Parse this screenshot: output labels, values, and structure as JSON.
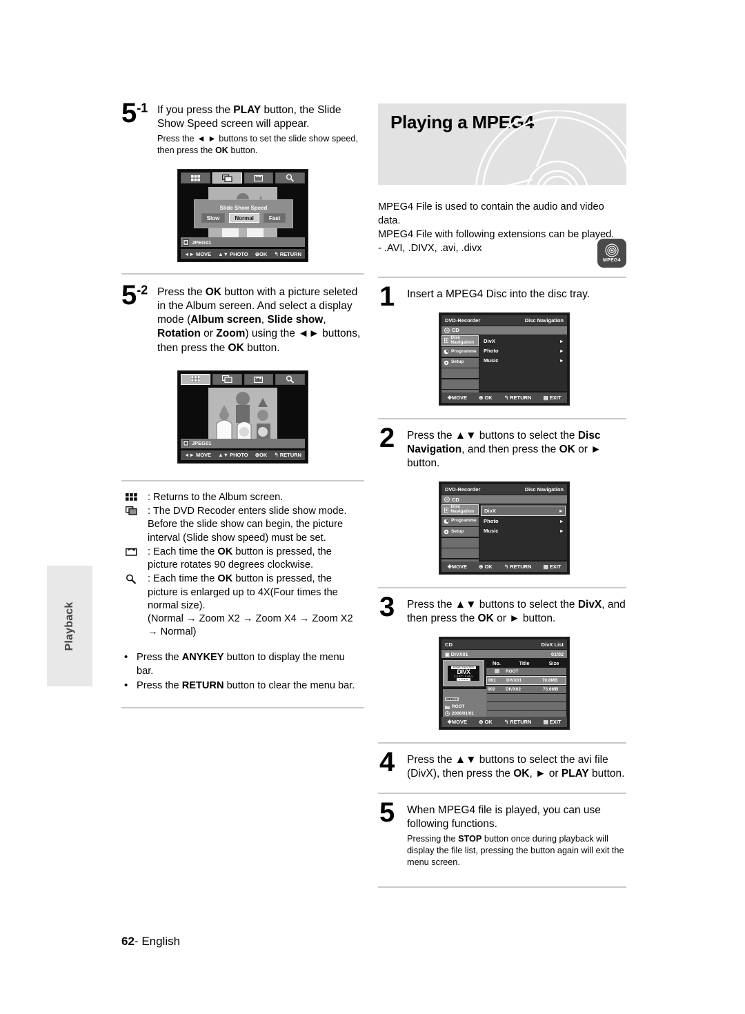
{
  "page": {
    "number": "62",
    "language": "English",
    "side_tab": "Playback"
  },
  "left_column": {
    "step_5_1": {
      "num": "5",
      "sup": "-1",
      "line1_a": "If you press the ",
      "line1_b": "PLAY",
      "line1_c": " button, the Slide Show Speed screen will appear.",
      "sub_a": "Press the ",
      "sub_arrows": "◄ ►",
      "sub_b": " buttons to set the slide show speed, then press the ",
      "sub_c": "OK",
      "sub_d": " button."
    },
    "osd_slideshow": {
      "toolbar_icons": [
        "album-icon",
        "slideshow-icon",
        "rotate-icon",
        "zoom-icon"
      ],
      "selected_tool": "slideshow-icon",
      "dialog_title": "Slide Show Speed",
      "options": [
        "Slow",
        "Normal",
        "Fast"
      ],
      "selected_option": "Normal",
      "file_label": "JPEG01",
      "keys": [
        "MOVE",
        "PHOTO",
        "OK",
        "RETURN"
      ]
    },
    "step_5_2": {
      "num": "5",
      "sup": "-2",
      "t1": "Press the ",
      "t2": "OK",
      "t3": " button with a picture seleted in the Album sereen. And select a display mode (",
      "t4": "Album screen",
      "t5": ", ",
      "t6": "Slide show",
      "t7": ", ",
      "t8": "Rotation",
      "t9": " or ",
      "t10": "Zoom",
      "t11": ") using the ",
      "t12": "◄►",
      "t13": " buttons, then press the ",
      "t14": "OK",
      "t15": " button."
    },
    "osd_album": {
      "toolbar_icons": [
        "album-icon",
        "slideshow-icon",
        "rotate-icon",
        "zoom-icon"
      ],
      "selected_tool": "album-icon",
      "file_label": "JPEG01",
      "keys": [
        "MOVE",
        "PHOTO",
        "OK",
        "RETURN"
      ]
    },
    "icon_list": [
      {
        "icon": "album-grid-icon",
        "text": ": Returns to the Album screen."
      },
      {
        "icon": "slideshow-icon",
        "text": ": The DVD Recoder enters slide show mode. Before the slide show can begin, the picture interval (Slide show speed) must be set."
      },
      {
        "icon": "rotate-icon",
        "text_a": ": Each time the ",
        "text_b": "OK",
        "text_c": " button is pressed, the picture rotates 90 degrees clockwise."
      },
      {
        "icon": "zoom-magnifier-icon",
        "text_a": ": Each time the ",
        "text_b": "OK",
        "text_c": " button is pressed, the picture is enlarged up to 4X(Four times the normal size).",
        "text_d": "(Normal → Zoom X2 → Zoom X4 → Zoom X2 → Normal)"
      }
    ],
    "bullets": [
      {
        "a": "Press the ",
        "b": "ANYKEY",
        "c": " button to display the menu bar."
      },
      {
        "a": "Press the ",
        "b": "RETURN",
        "c": " button to clear the menu bar."
      }
    ]
  },
  "right_column": {
    "title": "Playing a MPEG4",
    "intro_lines": [
      "MPEG4 File is used to contain the audio and video data.",
      "MPEG4 File with following extensions can be played.",
      "- .AVI, .DIVX, .avi, .divx"
    ],
    "badge": {
      "icon": "mpeg4-disc-icon",
      "label": "MPEG4"
    },
    "step1": {
      "num": "1",
      "text": "Insert a MPEG4 Disc into the disc tray."
    },
    "step2": {
      "num": "2",
      "a": "Press the ",
      "arrows": "▲▼",
      "b": " buttons to select the ",
      "c": "Disc Navigation",
      "d": ", and then press the ",
      "e": "OK",
      "f": " or ",
      "g": "►",
      "h": " button."
    },
    "step3": {
      "num": "3",
      "a": "Press the ",
      "arrows": "▲▼",
      "b": " buttons to select the ",
      "c": "DivX",
      "d": ", and then press the ",
      "e": "OK",
      "f": " or ",
      "g": "►",
      "h": " button."
    },
    "step4": {
      "num": "4",
      "a": "Press the ",
      "arrows": "▲▼",
      "b": " buttons to select the avi file (DivX), then press the ",
      "c": "OK",
      "d": ", ",
      "e": "►",
      "f": " or ",
      "g": "PLAY",
      "h": " button."
    },
    "step5": {
      "num": "5",
      "text": "When MPEG4 file is played, you can use following functions.",
      "sub_a": "Pressing the ",
      "sub_b": "STOP",
      "sub_c": " button once during playback will display the file list, pressing the button again will exit the menu screen."
    },
    "osd_nav_1": {
      "device": "DVD-Recorder",
      "header_right": "Disc Navigation",
      "disc": "CD",
      "sidebar": [
        "Disc Navigation",
        "Programme",
        "Setup"
      ],
      "sidebar_selected": "Disc Navigation",
      "items": [
        "DivX",
        "Photo",
        "Music"
      ],
      "item_selected": "",
      "keys": [
        "MOVE",
        "OK",
        "RETURN",
        "EXIT"
      ]
    },
    "osd_nav_2": {
      "device": "DVD-Recorder",
      "header_right": "Disc Navigation",
      "disc": "CD",
      "sidebar": [
        "Disc Navigation",
        "Programme",
        "Setup"
      ],
      "sidebar_selected": "Disc Navigation",
      "items": [
        "DivX",
        "Photo",
        "Music"
      ],
      "item_selected": "DivX",
      "keys": [
        "MOVE",
        "OK",
        "RETURN",
        "EXIT"
      ]
    },
    "osd_divx_list": {
      "header_left": "CD",
      "header_right": "DivX List",
      "sub_left": "DIVX01",
      "sub_right": "01/02",
      "logo": {
        "top": "HOME THEATER",
        "main": "DIVX",
        "certified": "CERTIFIED",
        "bottom": "VIDEO"
      },
      "info": {
        "tag": "MPEG4",
        "folder": "ROOT",
        "date": "2006/01/01",
        "size": "70.8MB"
      },
      "columns": [
        "No.",
        "Title",
        "Size"
      ],
      "rows": [
        {
          "no": "",
          "title": "ROOT",
          "size": "",
          "folder": true,
          "selected": false
        },
        {
          "no": "001",
          "title": "DIVX01",
          "size": "70.8MB",
          "folder": false,
          "selected": true
        },
        {
          "no": "002",
          "title": "DIVX02",
          "size": "73.6MB",
          "folder": false,
          "selected": false
        }
      ],
      "keys": [
        "MOVE",
        "OK",
        "RETURN",
        "EXIT"
      ]
    }
  }
}
